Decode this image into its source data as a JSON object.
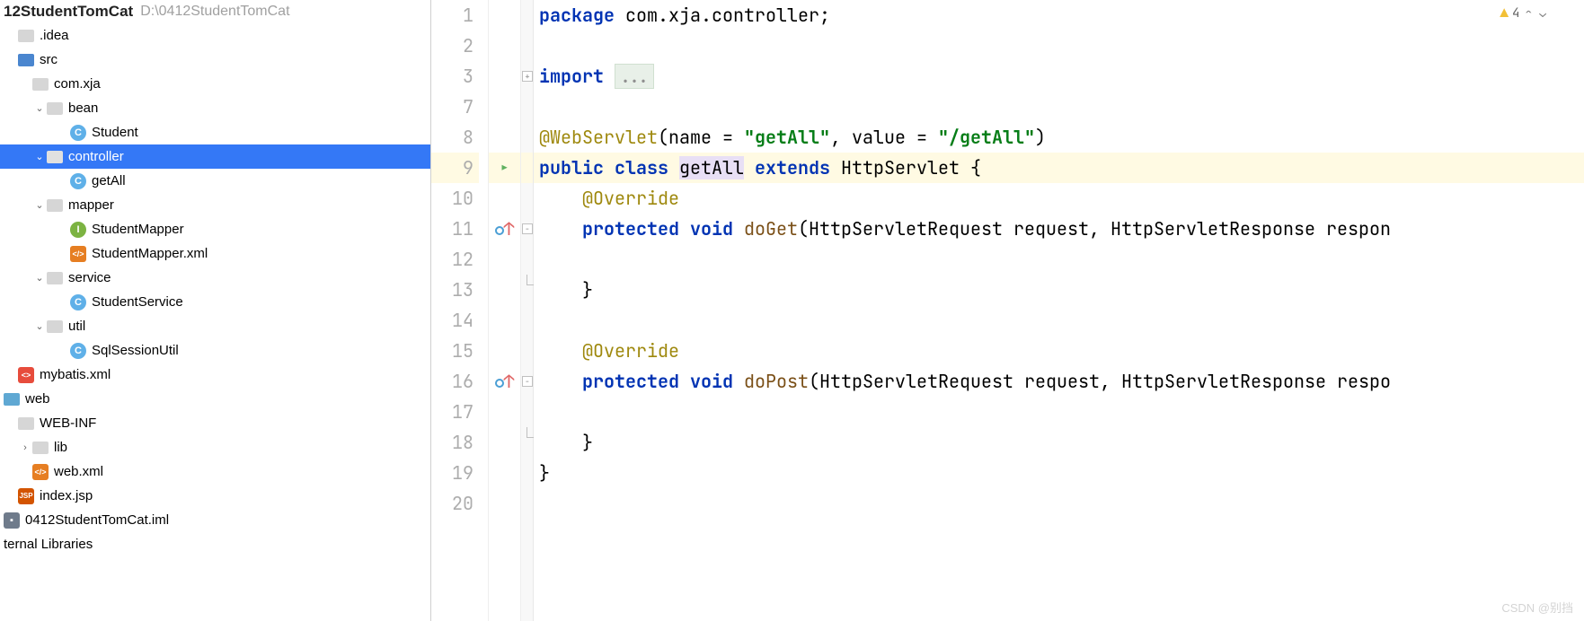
{
  "project": {
    "name": "12StudentTomCat",
    "path": "D:\\0412StudentTomCat"
  },
  "tree": {
    "idea": ".idea",
    "src": "src",
    "com_xja": "com.xja",
    "bean": "bean",
    "student": "Student",
    "controller": "controller",
    "getAll": "getAll",
    "mapper": "mapper",
    "studentMapper": "StudentMapper",
    "studentMapperXml": "StudentMapper.xml",
    "service": "service",
    "studentService": "StudentService",
    "util": "util",
    "sqlSessionUtil": "SqlSessionUtil",
    "mybatis": "mybatis.xml",
    "web": "web",
    "webinf": "WEB-INF",
    "lib": "lib",
    "webxml": "web.xml",
    "indexjsp": "index.jsp",
    "iml": "0412StudentTomCat.iml",
    "external": "ternal Libraries"
  },
  "editor": {
    "gutter": [
      "1",
      "2",
      "3",
      "7",
      "8",
      "9",
      "10",
      "11",
      "12",
      "13",
      "14",
      "15",
      "16",
      "17",
      "18",
      "19",
      "20"
    ],
    "warn_count": "4",
    "code": {
      "l1_kw": "package",
      "l1_pkg": " com.xja.controller;",
      "l3_kw": "import ",
      "l3_dots": "...",
      "l8_ann": "@WebServlet",
      "l8_p1": "(name = ",
      "l8_s1": "\"getAll\"",
      "l8_p2": ", value = ",
      "l8_s2": "\"/getAll\"",
      "l8_p3": ")",
      "l9_kw1": "public class ",
      "l9_cls": "getAll",
      "l9_kw2": " extends ",
      "l9_sup": "HttpServlet {",
      "l10_ann": "    @Override",
      "l11_kw1": "    protected void ",
      "l11_fn": "doGet",
      "l11_rest": "(HttpServletRequest request, HttpServletResponse respon",
      "l13_brace": "    }",
      "l15_ann": "    @Override",
      "l16_kw1": "    protected void ",
      "l16_fn": "doPost",
      "l16_rest": "(HttpServletRequest request, HttpServletResponse respo",
      "l18_brace": "    }",
      "l19_brace": "}"
    }
  },
  "watermark": "CSDN @别挡"
}
